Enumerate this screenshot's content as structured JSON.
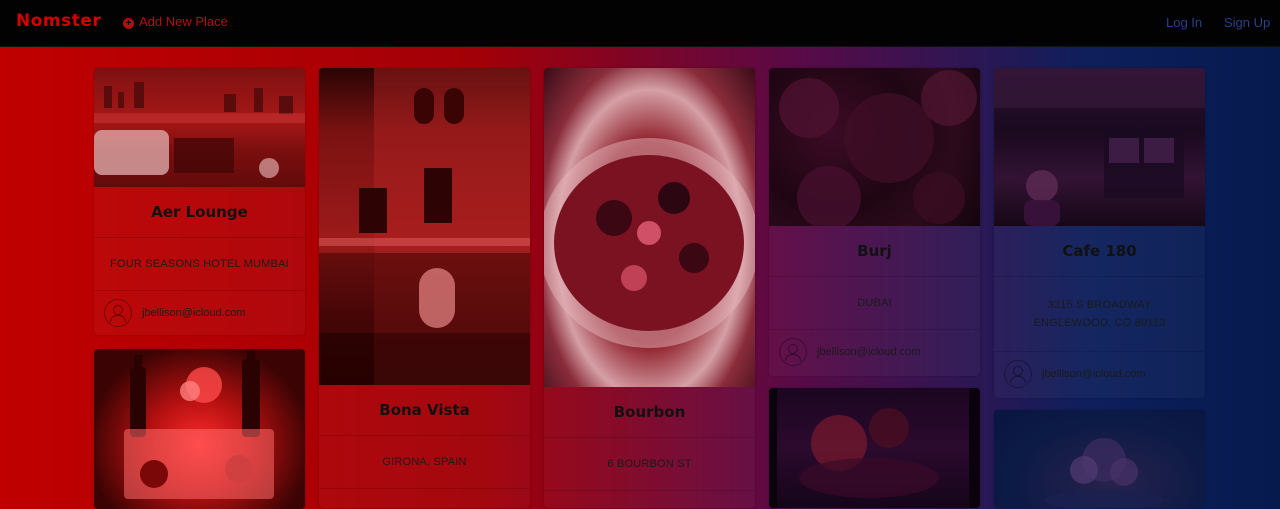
{
  "nav": {
    "brand": "Nomster",
    "add_place": "Add New Place",
    "login": "Log In",
    "signup": "Sign Up"
  },
  "places": [
    {
      "name": "Aer Lounge",
      "location": "FOUR SEASONS HOTEL MUMBAI",
      "user": "jbellison@icloud.com"
    },
    {
      "name": "Bona Vista",
      "location": "GIRONA, SPAIN",
      "user": ""
    },
    {
      "name": "Bourbon",
      "location": "6 BOURBON ST",
      "user": ""
    },
    {
      "name": "Burj",
      "location": "DUBAI",
      "user": "jbellison@icloud.com"
    },
    {
      "name": "Cafe 180",
      "location": "3315 S BROADWAY ENGLEWOOD, CO 80113",
      "user": "jbellison@icloud.com"
    }
  ],
  "colors": {
    "navbar": "#020202",
    "brand": "#d40000",
    "gradient_left": "#c00000",
    "gradient_right": "#061a4e"
  }
}
